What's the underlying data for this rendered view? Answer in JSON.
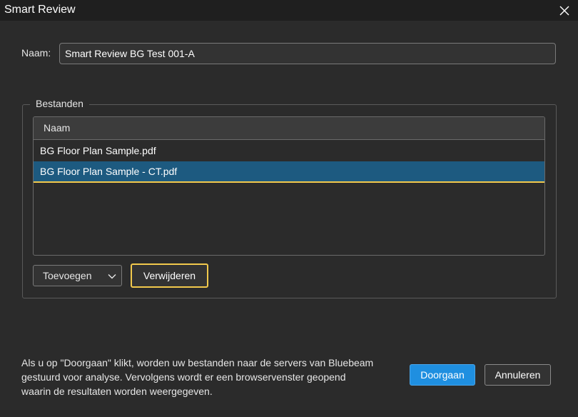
{
  "window": {
    "title": "Smart Review"
  },
  "form": {
    "name_label": "Naam:",
    "name_value": "Smart Review BG Test 001-A"
  },
  "files_group": {
    "legend": "Bestanden",
    "column_header": "Naam",
    "files": [
      {
        "name": "BG Floor Plan Sample.pdf",
        "selected": false
      },
      {
        "name": "BG Floor Plan Sample - CT.pdf",
        "selected": true
      }
    ],
    "add_dropdown_label": "Toevoegen",
    "remove_button_label": "Verwijderen"
  },
  "footer": {
    "notice_lines": [
      "Als u op \"Doorgaan\" klikt, worden uw bestanden naar de servers van Bluebeam",
      "gestuurd voor analyse. Vervolgens wordt er een browservenster geopend",
      "waarin de resultaten worden weergegeven."
    ],
    "continue_label": "Doorgaan",
    "cancel_label": "Annuleren"
  },
  "icons": {
    "close": "close-icon",
    "dropdown": "chevron-down-icon"
  },
  "colors": {
    "background": "#2b2b2b",
    "titlebar": "#1f1f1f",
    "selection": "#1d5a80",
    "focus_outline": "#f2c94c",
    "primary_button": "#1f8fe0"
  }
}
